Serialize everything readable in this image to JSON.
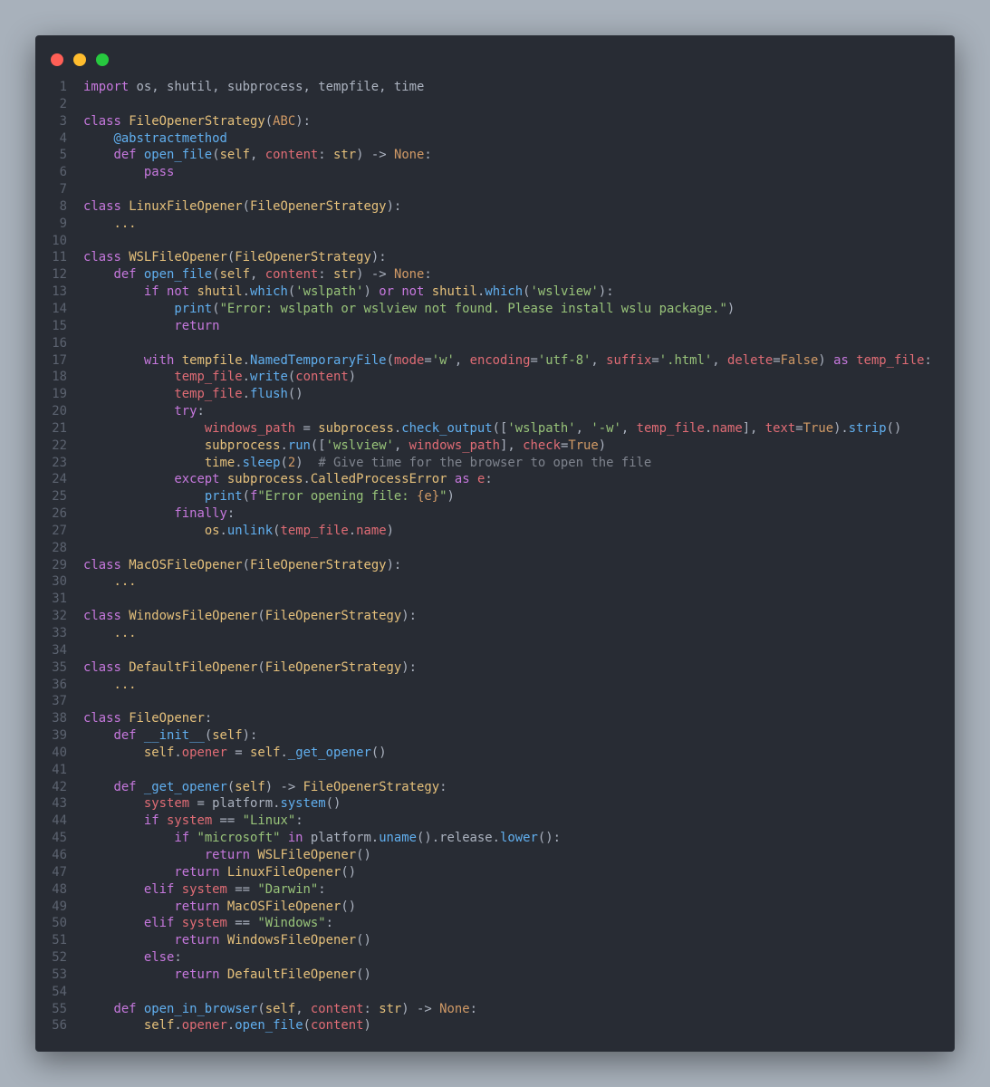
{
  "window": {
    "controls": [
      {
        "name": "close",
        "color": "#ff5f56"
      },
      {
        "name": "minimize",
        "color": "#ffbd2e"
      },
      {
        "name": "maximize",
        "color": "#27c93f"
      }
    ]
  },
  "colors": {
    "background": "#a8b1bb",
    "editor": "#282c34",
    "line_number": "#5c6370",
    "default": "#abb2bf",
    "keyword": "#c678dd",
    "class_name": "#e5c07b",
    "function": "#61afef",
    "string": "#98c379",
    "number": "#d19a66",
    "variable": "#e06c75",
    "comment": "#7f848e"
  },
  "code": {
    "lines": [
      [
        [
          "import",
          "k"
        ],
        [
          " os, shutil, subprocess, tempfile, time",
          "t"
        ]
      ],
      [],
      [
        [
          "class ",
          "k"
        ],
        [
          "FileOpenerStrategy",
          "c"
        ],
        [
          "(",
          "t"
        ],
        [
          "ABC",
          "n"
        ],
        [
          "):",
          "t"
        ]
      ],
      [
        [
          "    ",
          "t"
        ],
        [
          "@abstractmethod",
          "f"
        ]
      ],
      [
        [
          "    ",
          "t"
        ],
        [
          "def ",
          "k"
        ],
        [
          "open_file",
          "f"
        ],
        [
          "(",
          "t"
        ],
        [
          "self",
          "c"
        ],
        [
          ", ",
          "t"
        ],
        [
          "content",
          "v"
        ],
        [
          ": ",
          "t"
        ],
        [
          "str",
          "c"
        ],
        [
          ") -> ",
          "t"
        ],
        [
          "None",
          "n"
        ],
        [
          ":",
          "t"
        ]
      ],
      [
        [
          "        ",
          "t"
        ],
        [
          "pass",
          "k"
        ]
      ],
      [],
      [
        [
          "class ",
          "k"
        ],
        [
          "LinuxFileOpener",
          "c"
        ],
        [
          "(",
          "t"
        ],
        [
          "FileOpenerStrategy",
          "c"
        ],
        [
          "):",
          "t"
        ]
      ],
      [
        [
          "    ",
          "t"
        ],
        [
          "...",
          "c"
        ]
      ],
      [],
      [
        [
          "class ",
          "k"
        ],
        [
          "WSLFileOpener",
          "c"
        ],
        [
          "(",
          "t"
        ],
        [
          "FileOpenerStrategy",
          "c"
        ],
        [
          "):",
          "t"
        ]
      ],
      [
        [
          "    ",
          "t"
        ],
        [
          "def ",
          "k"
        ],
        [
          "open_file",
          "f"
        ],
        [
          "(",
          "t"
        ],
        [
          "self",
          "c"
        ],
        [
          ", ",
          "t"
        ],
        [
          "content",
          "v"
        ],
        [
          ": ",
          "t"
        ],
        [
          "str",
          "c"
        ],
        [
          ") -> ",
          "t"
        ],
        [
          "None",
          "n"
        ],
        [
          ":",
          "t"
        ]
      ],
      [
        [
          "        ",
          "t"
        ],
        [
          "if not ",
          "k"
        ],
        [
          "shutil",
          "c"
        ],
        [
          ".",
          "t"
        ],
        [
          "which",
          "f"
        ],
        [
          "(",
          "t"
        ],
        [
          "'wslpath'",
          "s"
        ],
        [
          ") ",
          "t"
        ],
        [
          "or not ",
          "k"
        ],
        [
          "shutil",
          "c"
        ],
        [
          ".",
          "t"
        ],
        [
          "which",
          "f"
        ],
        [
          "(",
          "t"
        ],
        [
          "'wslview'",
          "s"
        ],
        [
          "):",
          "t"
        ]
      ],
      [
        [
          "            ",
          "t"
        ],
        [
          "print",
          "f"
        ],
        [
          "(",
          "t"
        ],
        [
          "\"Error: wslpath or wslview not found. Please install wslu package.\"",
          "s"
        ],
        [
          ")",
          "t"
        ]
      ],
      [
        [
          "            ",
          "t"
        ],
        [
          "return",
          "k"
        ]
      ],
      [],
      [
        [
          "        ",
          "t"
        ],
        [
          "with ",
          "k"
        ],
        [
          "tempfile",
          "c"
        ],
        [
          ".",
          "t"
        ],
        [
          "NamedTemporaryFile",
          "f"
        ],
        [
          "(",
          "t"
        ],
        [
          "mode",
          "v"
        ],
        [
          "=",
          "t"
        ],
        [
          "'w'",
          "s"
        ],
        [
          ", ",
          "t"
        ],
        [
          "encoding",
          "v"
        ],
        [
          "=",
          "t"
        ],
        [
          "'utf-8'",
          "s"
        ],
        [
          ", ",
          "t"
        ],
        [
          "suffix",
          "v"
        ],
        [
          "=",
          "t"
        ],
        [
          "'.html'",
          "s"
        ],
        [
          ", ",
          "t"
        ],
        [
          "delete",
          "v"
        ],
        [
          "=",
          "t"
        ],
        [
          "False",
          "n"
        ],
        [
          ") ",
          "t"
        ],
        [
          "as ",
          "k"
        ],
        [
          "temp_file",
          "v"
        ],
        [
          ":",
          "t"
        ]
      ],
      [
        [
          "            ",
          "t"
        ],
        [
          "temp_file",
          "v"
        ],
        [
          ".",
          "t"
        ],
        [
          "write",
          "f"
        ],
        [
          "(",
          "t"
        ],
        [
          "content",
          "v"
        ],
        [
          ")",
          "t"
        ]
      ],
      [
        [
          "            ",
          "t"
        ],
        [
          "temp_file",
          "v"
        ],
        [
          ".",
          "t"
        ],
        [
          "flush",
          "f"
        ],
        [
          "()",
          "t"
        ]
      ],
      [
        [
          "            ",
          "t"
        ],
        [
          "try",
          "k"
        ],
        [
          ":",
          "t"
        ]
      ],
      [
        [
          "                ",
          "t"
        ],
        [
          "windows_path",
          "v"
        ],
        [
          " = ",
          "t"
        ],
        [
          "subprocess",
          "c"
        ],
        [
          ".",
          "t"
        ],
        [
          "check_output",
          "f"
        ],
        [
          "([",
          "t"
        ],
        [
          "'wslpath'",
          "s"
        ],
        [
          ", ",
          "t"
        ],
        [
          "'-w'",
          "s"
        ],
        [
          ", ",
          "t"
        ],
        [
          "temp_file",
          "v"
        ],
        [
          ".",
          "t"
        ],
        [
          "name",
          "v"
        ],
        [
          "], ",
          "t"
        ],
        [
          "text",
          "v"
        ],
        [
          "=",
          "t"
        ],
        [
          "True",
          "n"
        ],
        [
          ").",
          "t"
        ],
        [
          "strip",
          "f"
        ],
        [
          "()",
          "t"
        ]
      ],
      [
        [
          "                ",
          "t"
        ],
        [
          "subprocess",
          "c"
        ],
        [
          ".",
          "t"
        ],
        [
          "run",
          "f"
        ],
        [
          "([",
          "t"
        ],
        [
          "'wslview'",
          "s"
        ],
        [
          ", ",
          "t"
        ],
        [
          "windows_path",
          "v"
        ],
        [
          "], ",
          "t"
        ],
        [
          "check",
          "v"
        ],
        [
          "=",
          "t"
        ],
        [
          "True",
          "n"
        ],
        [
          ")",
          "t"
        ]
      ],
      [
        [
          "                ",
          "t"
        ],
        [
          "time",
          "c"
        ],
        [
          ".",
          "t"
        ],
        [
          "sleep",
          "f"
        ],
        [
          "(",
          "t"
        ],
        [
          "2",
          "n"
        ],
        [
          ")  ",
          "t"
        ],
        [
          "# Give time for the browser to open the file",
          "m"
        ]
      ],
      [
        [
          "            ",
          "t"
        ],
        [
          "except ",
          "k"
        ],
        [
          "subprocess",
          "c"
        ],
        [
          ".",
          "t"
        ],
        [
          "CalledProcessError",
          "c"
        ],
        [
          " ",
          "t"
        ],
        [
          "as ",
          "k"
        ],
        [
          "e",
          "v"
        ],
        [
          ":",
          "t"
        ]
      ],
      [
        [
          "                ",
          "t"
        ],
        [
          "print",
          "f"
        ],
        [
          "(",
          "t"
        ],
        [
          "f",
          "k"
        ],
        [
          "\"Error opening file: ",
          "s"
        ],
        [
          "{e}",
          "n"
        ],
        [
          "\"",
          "s"
        ],
        [
          ")",
          "t"
        ]
      ],
      [
        [
          "            ",
          "t"
        ],
        [
          "finally",
          "k"
        ],
        [
          ":",
          "t"
        ]
      ],
      [
        [
          "                ",
          "t"
        ],
        [
          "os",
          "c"
        ],
        [
          ".",
          "t"
        ],
        [
          "unlink",
          "f"
        ],
        [
          "(",
          "t"
        ],
        [
          "temp_file",
          "v"
        ],
        [
          ".",
          "t"
        ],
        [
          "name",
          "v"
        ],
        [
          ")",
          "t"
        ]
      ],
      [],
      [
        [
          "class ",
          "k"
        ],
        [
          "MacOSFileOpener",
          "c"
        ],
        [
          "(",
          "t"
        ],
        [
          "FileOpenerStrategy",
          "c"
        ],
        [
          "):",
          "t"
        ]
      ],
      [
        [
          "    ",
          "t"
        ],
        [
          "...",
          "c"
        ]
      ],
      [],
      [
        [
          "class ",
          "k"
        ],
        [
          "WindowsFileOpener",
          "c"
        ],
        [
          "(",
          "t"
        ],
        [
          "FileOpenerStrategy",
          "c"
        ],
        [
          "):",
          "t"
        ]
      ],
      [
        [
          "    ",
          "t"
        ],
        [
          "...",
          "c"
        ]
      ],
      [],
      [
        [
          "class ",
          "k"
        ],
        [
          "DefaultFileOpener",
          "c"
        ],
        [
          "(",
          "t"
        ],
        [
          "FileOpenerStrategy",
          "c"
        ],
        [
          "):",
          "t"
        ]
      ],
      [
        [
          "    ",
          "t"
        ],
        [
          "...",
          "c"
        ]
      ],
      [],
      [
        [
          "class ",
          "k"
        ],
        [
          "FileOpener",
          "c"
        ],
        [
          ":",
          "t"
        ]
      ],
      [
        [
          "    ",
          "t"
        ],
        [
          "def ",
          "k"
        ],
        [
          "__init__",
          "f"
        ],
        [
          "(",
          "t"
        ],
        [
          "self",
          "c"
        ],
        [
          "):",
          "t"
        ]
      ],
      [
        [
          "        ",
          "t"
        ],
        [
          "self",
          "c"
        ],
        [
          ".",
          "t"
        ],
        [
          "opener",
          "v"
        ],
        [
          " = ",
          "t"
        ],
        [
          "self",
          "c"
        ],
        [
          ".",
          "t"
        ],
        [
          "_get_opener",
          "f"
        ],
        [
          "()",
          "t"
        ]
      ],
      [],
      [
        [
          "    ",
          "t"
        ],
        [
          "def ",
          "k"
        ],
        [
          "_get_opener",
          "f"
        ],
        [
          "(",
          "t"
        ],
        [
          "self",
          "c"
        ],
        [
          ") -> ",
          "t"
        ],
        [
          "FileOpenerStrategy",
          "c"
        ],
        [
          ":",
          "t"
        ]
      ],
      [
        [
          "        ",
          "t"
        ],
        [
          "system",
          "v"
        ],
        [
          " = platform.",
          "t"
        ],
        [
          "system",
          "f"
        ],
        [
          "()",
          "t"
        ]
      ],
      [
        [
          "        ",
          "t"
        ],
        [
          "if ",
          "k"
        ],
        [
          "system",
          "v"
        ],
        [
          " == ",
          "t"
        ],
        [
          "\"Linux\"",
          "s"
        ],
        [
          ":",
          "t"
        ]
      ],
      [
        [
          "            ",
          "t"
        ],
        [
          "if ",
          "k"
        ],
        [
          "\"microsoft\"",
          "s"
        ],
        [
          " in ",
          "k"
        ],
        [
          "platform.",
          "t"
        ],
        [
          "uname",
          "f"
        ],
        [
          "().release.",
          "t"
        ],
        [
          "lower",
          "f"
        ],
        [
          "():",
          "t"
        ]
      ],
      [
        [
          "                ",
          "t"
        ],
        [
          "return ",
          "k"
        ],
        [
          "WSLFileOpener",
          "c"
        ],
        [
          "()",
          "t"
        ]
      ],
      [
        [
          "            ",
          "t"
        ],
        [
          "return ",
          "k"
        ],
        [
          "LinuxFileOpener",
          "c"
        ],
        [
          "()",
          "t"
        ]
      ],
      [
        [
          "        ",
          "t"
        ],
        [
          "elif ",
          "k"
        ],
        [
          "system",
          "v"
        ],
        [
          " == ",
          "t"
        ],
        [
          "\"Darwin\"",
          "s"
        ],
        [
          ":",
          "t"
        ]
      ],
      [
        [
          "            ",
          "t"
        ],
        [
          "return ",
          "k"
        ],
        [
          "MacOSFileOpener",
          "c"
        ],
        [
          "()",
          "t"
        ]
      ],
      [
        [
          "        ",
          "t"
        ],
        [
          "elif ",
          "k"
        ],
        [
          "system",
          "v"
        ],
        [
          " == ",
          "t"
        ],
        [
          "\"Windows\"",
          "s"
        ],
        [
          ":",
          "t"
        ]
      ],
      [
        [
          "            ",
          "t"
        ],
        [
          "return ",
          "k"
        ],
        [
          "WindowsFileOpener",
          "c"
        ],
        [
          "()",
          "t"
        ]
      ],
      [
        [
          "        ",
          "t"
        ],
        [
          "else",
          "k"
        ],
        [
          ":",
          "t"
        ]
      ],
      [
        [
          "            ",
          "t"
        ],
        [
          "return ",
          "k"
        ],
        [
          "DefaultFileOpener",
          "c"
        ],
        [
          "()",
          "t"
        ]
      ],
      [],
      [
        [
          "    ",
          "t"
        ],
        [
          "def ",
          "k"
        ],
        [
          "open_in_browser",
          "f"
        ],
        [
          "(",
          "t"
        ],
        [
          "self",
          "c"
        ],
        [
          ", ",
          "t"
        ],
        [
          "content",
          "v"
        ],
        [
          ": ",
          "t"
        ],
        [
          "str",
          "c"
        ],
        [
          ") -> ",
          "t"
        ],
        [
          "None",
          "n"
        ],
        [
          ":",
          "t"
        ]
      ],
      [
        [
          "        ",
          "t"
        ],
        [
          "self",
          "c"
        ],
        [
          ".",
          "t"
        ],
        [
          "opener",
          "v"
        ],
        [
          ".",
          "t"
        ],
        [
          "open_file",
          "f"
        ],
        [
          "(",
          "t"
        ],
        [
          "content",
          "v"
        ],
        [
          ")",
          "t"
        ]
      ]
    ]
  }
}
